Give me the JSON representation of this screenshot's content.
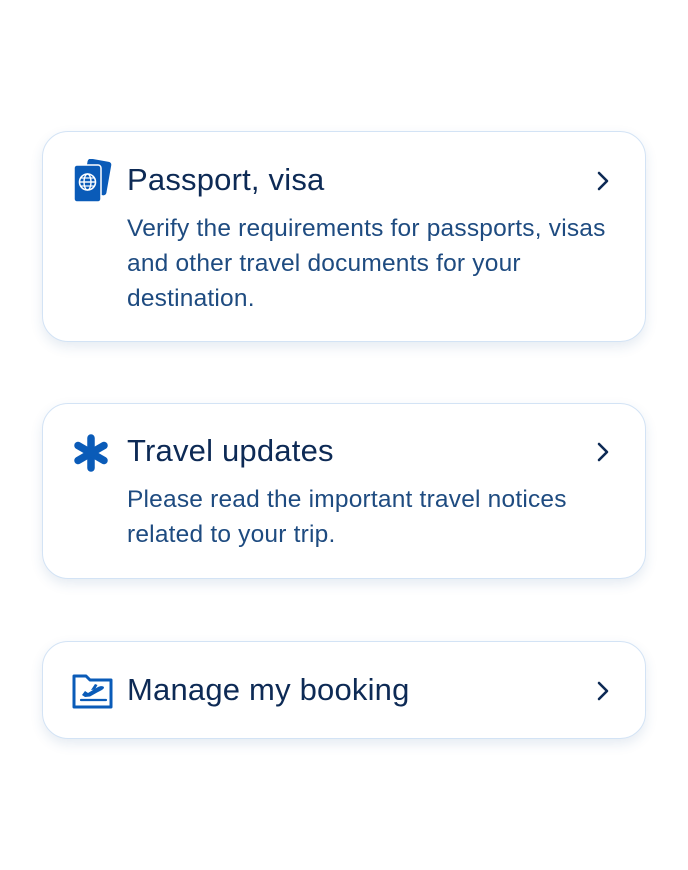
{
  "colors": {
    "icon_blue": "#0a5bb8",
    "title_navy": "#0d2a55",
    "text_blue": "#1e4b80",
    "border": "#d3e3f5"
  },
  "cards": [
    {
      "icon": "passport-icon",
      "title": "Passport, visa",
      "description": "Verify the requirements for passports, visas and other travel documents for your destination."
    },
    {
      "icon": "asterisk-icon",
      "title": "Travel updates",
      "description": "Please read the important travel notices related to your trip."
    },
    {
      "icon": "booking-folder-icon",
      "title": "Manage my booking"
    }
  ]
}
